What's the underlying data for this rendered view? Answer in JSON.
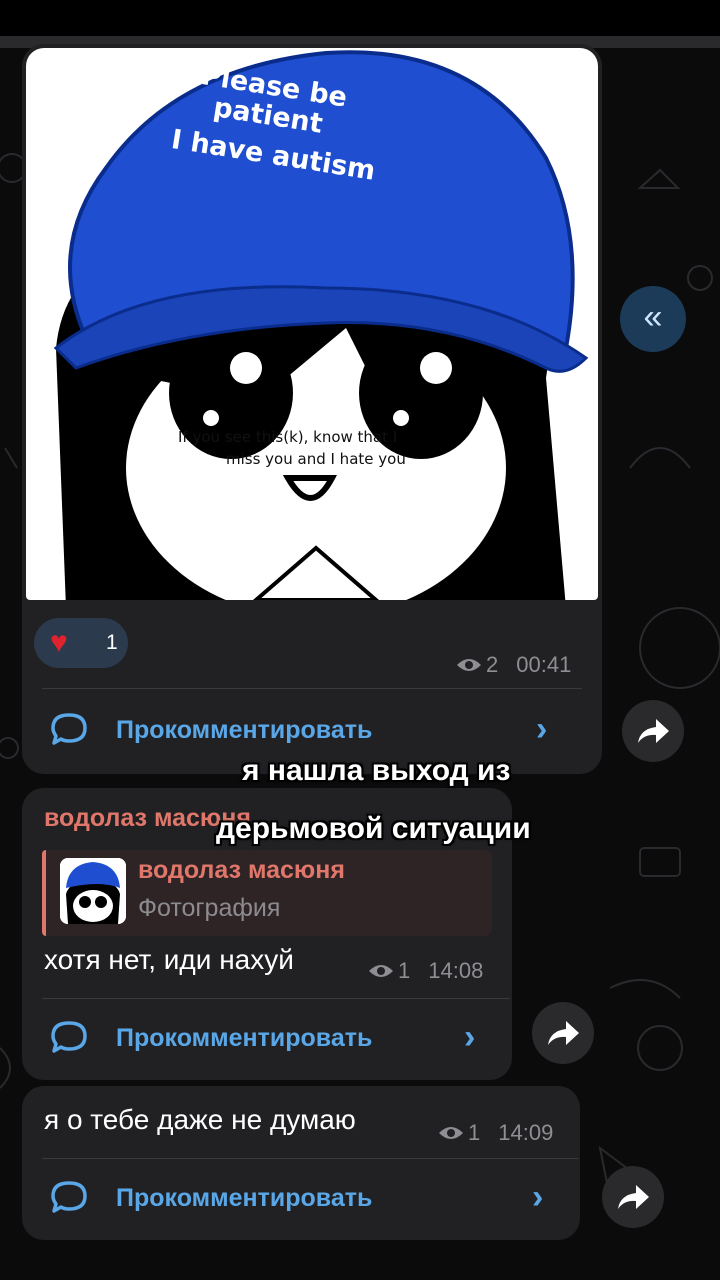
{
  "post1": {
    "image": {
      "cap_text_lines": [
        "Please be",
        "patient",
        "I have autism"
      ],
      "face_text_lines": [
        "If you see this(k), know that I",
        "miss you and I hate you"
      ]
    },
    "reaction": {
      "emoji": "heart-icon",
      "count": "1"
    },
    "views": "2",
    "time": "00:41",
    "comment_label": "Прокомментировать"
  },
  "post2": {
    "sender": "водолаз масюня",
    "reply": {
      "name": "водолаз масюня",
      "subtitle": "Фотография"
    },
    "text": "хотя нет, иди нахуй",
    "views": "1",
    "time": "14:08",
    "comment_label": "Прокомментировать"
  },
  "post3": {
    "text": "я о тебе даже не думаю",
    "views": "1",
    "time": "14:09",
    "comment_label": "Прокомментировать"
  },
  "overlay_caption": {
    "line1": "я нашла выход из",
    "line2": "дерьмовой ситуации"
  },
  "scroll_button": {
    "icon": "double-chevron-left-icon",
    "glyph": "«"
  },
  "colors": {
    "bubble": "#212124",
    "accent_link": "#5aa7e8",
    "sender": "#e0776a",
    "cap_blue": "#1f4fd0",
    "heart": "#e0222e"
  }
}
